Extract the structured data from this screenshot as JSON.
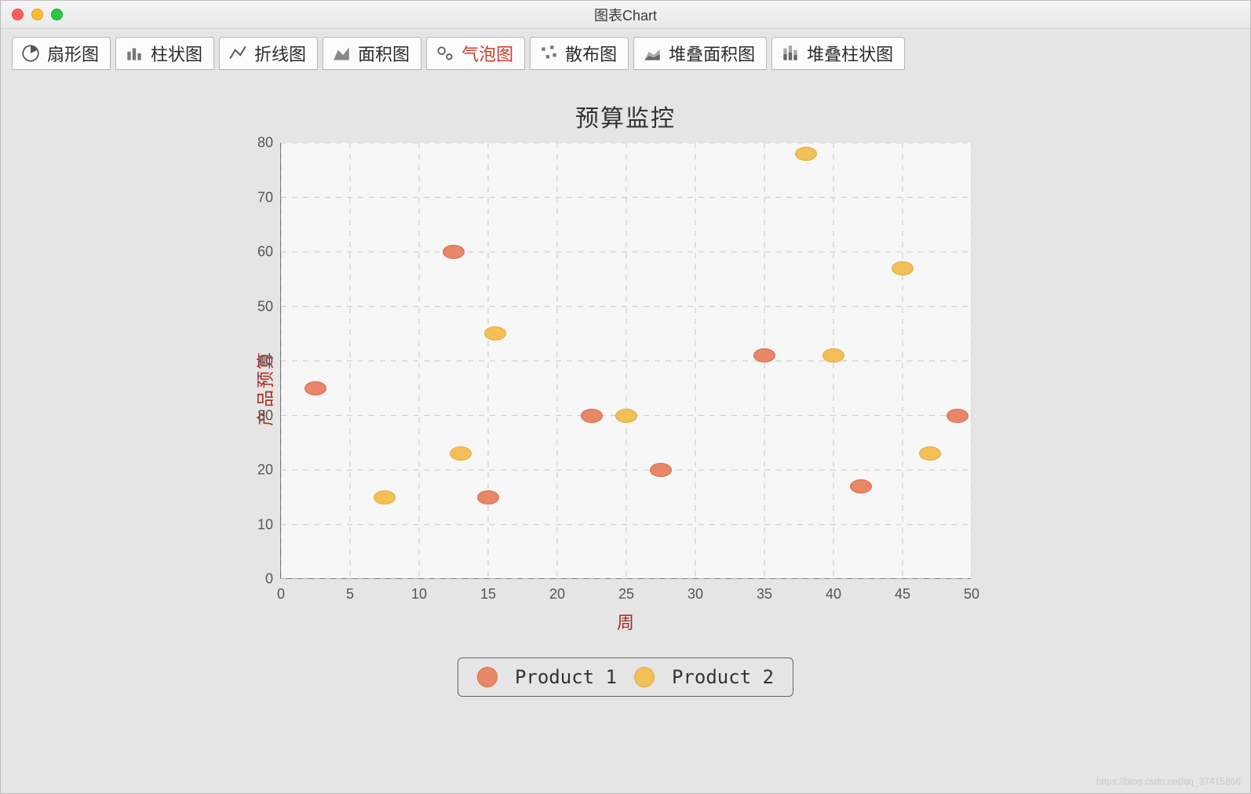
{
  "window": {
    "title": "图表Chart"
  },
  "tabs": [
    {
      "key": "pie",
      "label": "扇形图"
    },
    {
      "key": "bar",
      "label": "柱状图"
    },
    {
      "key": "line",
      "label": "折线图"
    },
    {
      "key": "area",
      "label": "面积图"
    },
    {
      "key": "bubble",
      "label": "气泡图",
      "active": true
    },
    {
      "key": "scatter",
      "label": "散布图"
    },
    {
      "key": "stackarea",
      "label": "堆叠面积图"
    },
    {
      "key": "stackbar",
      "label": "堆叠柱状图"
    }
  ],
  "legend": [
    {
      "name": "Product 1",
      "color": "#e88767"
    },
    {
      "name": "Product 2",
      "color": "#f2c056"
    }
  ],
  "chart_data": {
    "type": "scatter",
    "title": "预算监控",
    "xlabel": "周",
    "ylabel": "产品预算",
    "xlim": [
      0,
      50
    ],
    "ylim": [
      0,
      80
    ],
    "xticks": [
      0,
      5,
      10,
      15,
      20,
      25,
      30,
      35,
      40,
      45,
      50
    ],
    "yticks": [
      0,
      10,
      20,
      30,
      40,
      50,
      60,
      70,
      80
    ],
    "series": [
      {
        "name": "Product 1",
        "points": [
          {
            "x": 2.5,
            "y": 35
          },
          {
            "x": 12.5,
            "y": 60
          },
          {
            "x": 15,
            "y": 15
          },
          {
            "x": 22.5,
            "y": 30
          },
          {
            "x": 27.5,
            "y": 20
          },
          {
            "x": 35,
            "y": 41
          },
          {
            "x": 42,
            "y": 17
          },
          {
            "x": 49,
            "y": 30
          }
        ]
      },
      {
        "name": "Product 2",
        "points": [
          {
            "x": 7.5,
            "y": 15
          },
          {
            "x": 13,
            "y": 23
          },
          {
            "x": 15.5,
            "y": 45
          },
          {
            "x": 25,
            "y": 30
          },
          {
            "x": 38,
            "y": 78
          },
          {
            "x": 40,
            "y": 41
          },
          {
            "x": 45,
            "y": 57
          },
          {
            "x": 47,
            "y": 23
          }
        ]
      }
    ]
  },
  "watermark": "https://blog.csdn.net/qq_37415866"
}
